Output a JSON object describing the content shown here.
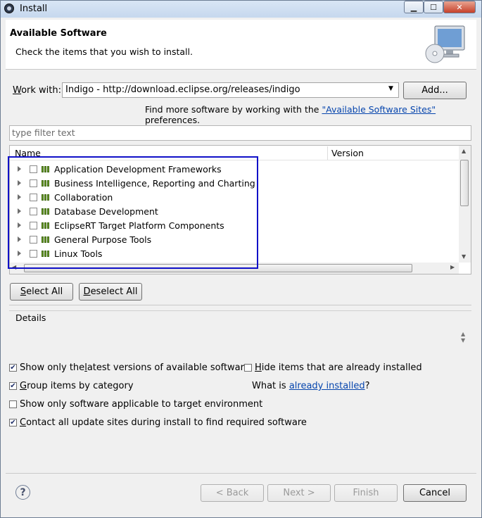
{
  "window": {
    "title": "Install"
  },
  "header": {
    "title": "Available Software",
    "subtitle": "Check the items that you wish to install."
  },
  "work_with": {
    "label_prefix": "W",
    "label_rest": "ork with:",
    "value": "Indigo - http://download.eclipse.org/releases/indigo",
    "add_button": "Add...",
    "hint_prefix": "Find more software by working with the ",
    "hint_link": "\"Available Software Sites\"",
    "hint_suffix": " preferences."
  },
  "filter": {
    "placeholder": "type filter text"
  },
  "tree": {
    "columns": [
      "Name",
      "Version"
    ],
    "items": [
      {
        "label": "Application Development Frameworks"
      },
      {
        "label": "Business Intelligence, Reporting and Charting"
      },
      {
        "label": "Collaboration"
      },
      {
        "label": "Database Development"
      },
      {
        "label": "EclipseRT Target Platform Components"
      },
      {
        "label": "General Purpose Tools"
      },
      {
        "label": "Linux Tools"
      }
    ]
  },
  "buttons": {
    "select_all_u": "S",
    "select_all_rest": "elect All",
    "deselect_all_u": "D",
    "deselect_all_rest": "eselect All"
  },
  "details": {
    "label": "Details"
  },
  "options": {
    "latest_pre": "Show only the ",
    "latest_u": "l",
    "latest_post": "atest versions of available software",
    "latest_checked": true,
    "hide_u": "H",
    "hide_post": "ide items that are already installed",
    "hide_checked": false,
    "group_u": "G",
    "group_post": "roup items by category",
    "group_checked": true,
    "what_is_prefix": "What is ",
    "what_is_link": "already installed",
    "what_is_suffix": "?",
    "target_env": "Show only software applicable to target environment",
    "target_checked": false,
    "contact_u": "C",
    "contact_post": "ontact all update sites during install to find required software",
    "contact_checked": true
  },
  "footer": {
    "back": "< Back",
    "back_u": "B",
    "next": "Next >",
    "next_u": "N",
    "finish": "Finish",
    "finish_u": "F",
    "cancel": "Cancel"
  },
  "colors": {
    "highlight_box": "#1010c8",
    "link": "#0645ad"
  }
}
